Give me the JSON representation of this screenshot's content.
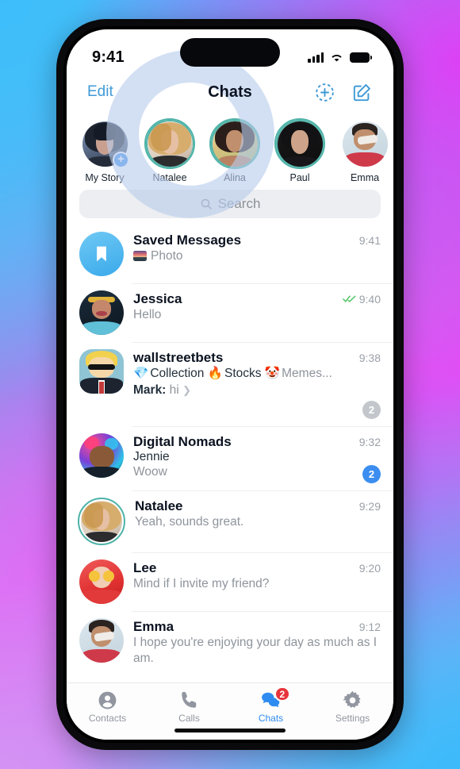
{
  "status_bar": {
    "time": "9:41",
    "signal_icon": "cellular-bars-icon",
    "wifi_icon": "wifi-icon",
    "battery_icon": "battery-icon"
  },
  "nav": {
    "edit_label": "Edit",
    "title": "Chats",
    "add_story_icon": "add-story-icon",
    "compose_icon": "compose-icon"
  },
  "stories": [
    {
      "name": "My Story",
      "has_ring": false,
      "has_add": true
    },
    {
      "name": "Natalee",
      "has_ring": true,
      "has_add": false
    },
    {
      "name": "Alina",
      "has_ring": true,
      "has_add": false
    },
    {
      "name": "Paul",
      "has_ring": true,
      "has_add": false
    },
    {
      "name": "Emma",
      "has_ring": false,
      "has_add": false
    }
  ],
  "search": {
    "placeholder": "Search",
    "icon": "search-icon"
  },
  "chats": [
    {
      "name": "Saved Messages",
      "time": "9:41",
      "preview": "Photo",
      "has_photo_thumb": true,
      "avatar_type": "saved-bookmark",
      "ticks": false,
      "badge": null,
      "badge_style": null,
      "sender": null,
      "topics": null,
      "ring": false
    },
    {
      "name": "Jessica",
      "time": "9:40",
      "preview": "Hello",
      "has_photo_thumb": false,
      "avatar_type": "jessica",
      "ticks": true,
      "badge": null,
      "badge_style": null,
      "sender": null,
      "topics": null,
      "ring": false
    },
    {
      "name": "wallstreetbets",
      "time": "9:38",
      "preview": null,
      "has_photo_thumb": false,
      "avatar_type": "wsb",
      "ticks": false,
      "badge": "2",
      "badge_style": "gray",
      "sender": "Mark:",
      "sender_message": "hi",
      "topics": [
        {
          "emoji": "💎",
          "label": "Collection"
        },
        {
          "emoji": "🔥",
          "label": "Stocks"
        },
        {
          "emoji": "🤡",
          "label": "Memes..."
        }
      ],
      "ring": false
    },
    {
      "name": "Digital Nomads",
      "time": "9:32",
      "preview": "Woow",
      "has_photo_thumb": false,
      "avatar_type": "nomads",
      "ticks": false,
      "badge": "2",
      "badge_style": "blue",
      "sender": "Jennie",
      "topics": null,
      "ring": false
    },
    {
      "name": "Natalee",
      "time": "9:29",
      "preview": "Yeah, sounds great.",
      "has_photo_thumb": false,
      "avatar_type": "natalee",
      "ticks": false,
      "badge": null,
      "badge_style": null,
      "sender": null,
      "topics": null,
      "ring": true
    },
    {
      "name": "Lee",
      "time": "9:20",
      "preview": "Mind if I invite my friend?",
      "has_photo_thumb": false,
      "avatar_type": "lee",
      "ticks": false,
      "badge": null,
      "badge_style": null,
      "sender": null,
      "topics": null,
      "ring": false
    },
    {
      "name": "Emma",
      "time": "9:12",
      "preview": "I hope you're enjoying your day as much as I am.",
      "has_photo_thumb": false,
      "avatar_type": "emma",
      "ticks": false,
      "badge": null,
      "badge_style": null,
      "sender": null,
      "topics": null,
      "ring": false
    }
  ],
  "tabs": [
    {
      "label": "Contacts",
      "icon": "contacts-icon",
      "active": false,
      "badge": null
    },
    {
      "label": "Calls",
      "icon": "phone-icon",
      "active": false,
      "badge": null
    },
    {
      "label": "Chats",
      "icon": "chat-bubbles-icon",
      "active": true,
      "badge": "2"
    },
    {
      "label": "Settings",
      "icon": "gear-icon",
      "active": false,
      "badge": null
    }
  ],
  "colors": {
    "accent_blue": "#3b8ef0",
    "tab_active": "#2e8bf0",
    "nav_link": "#3f9ad6",
    "badge_red": "#e8333a",
    "badge_gray": "#c3c7cc",
    "tick_green": "#4cc45f",
    "story_ring": "#4fb3a8"
  }
}
